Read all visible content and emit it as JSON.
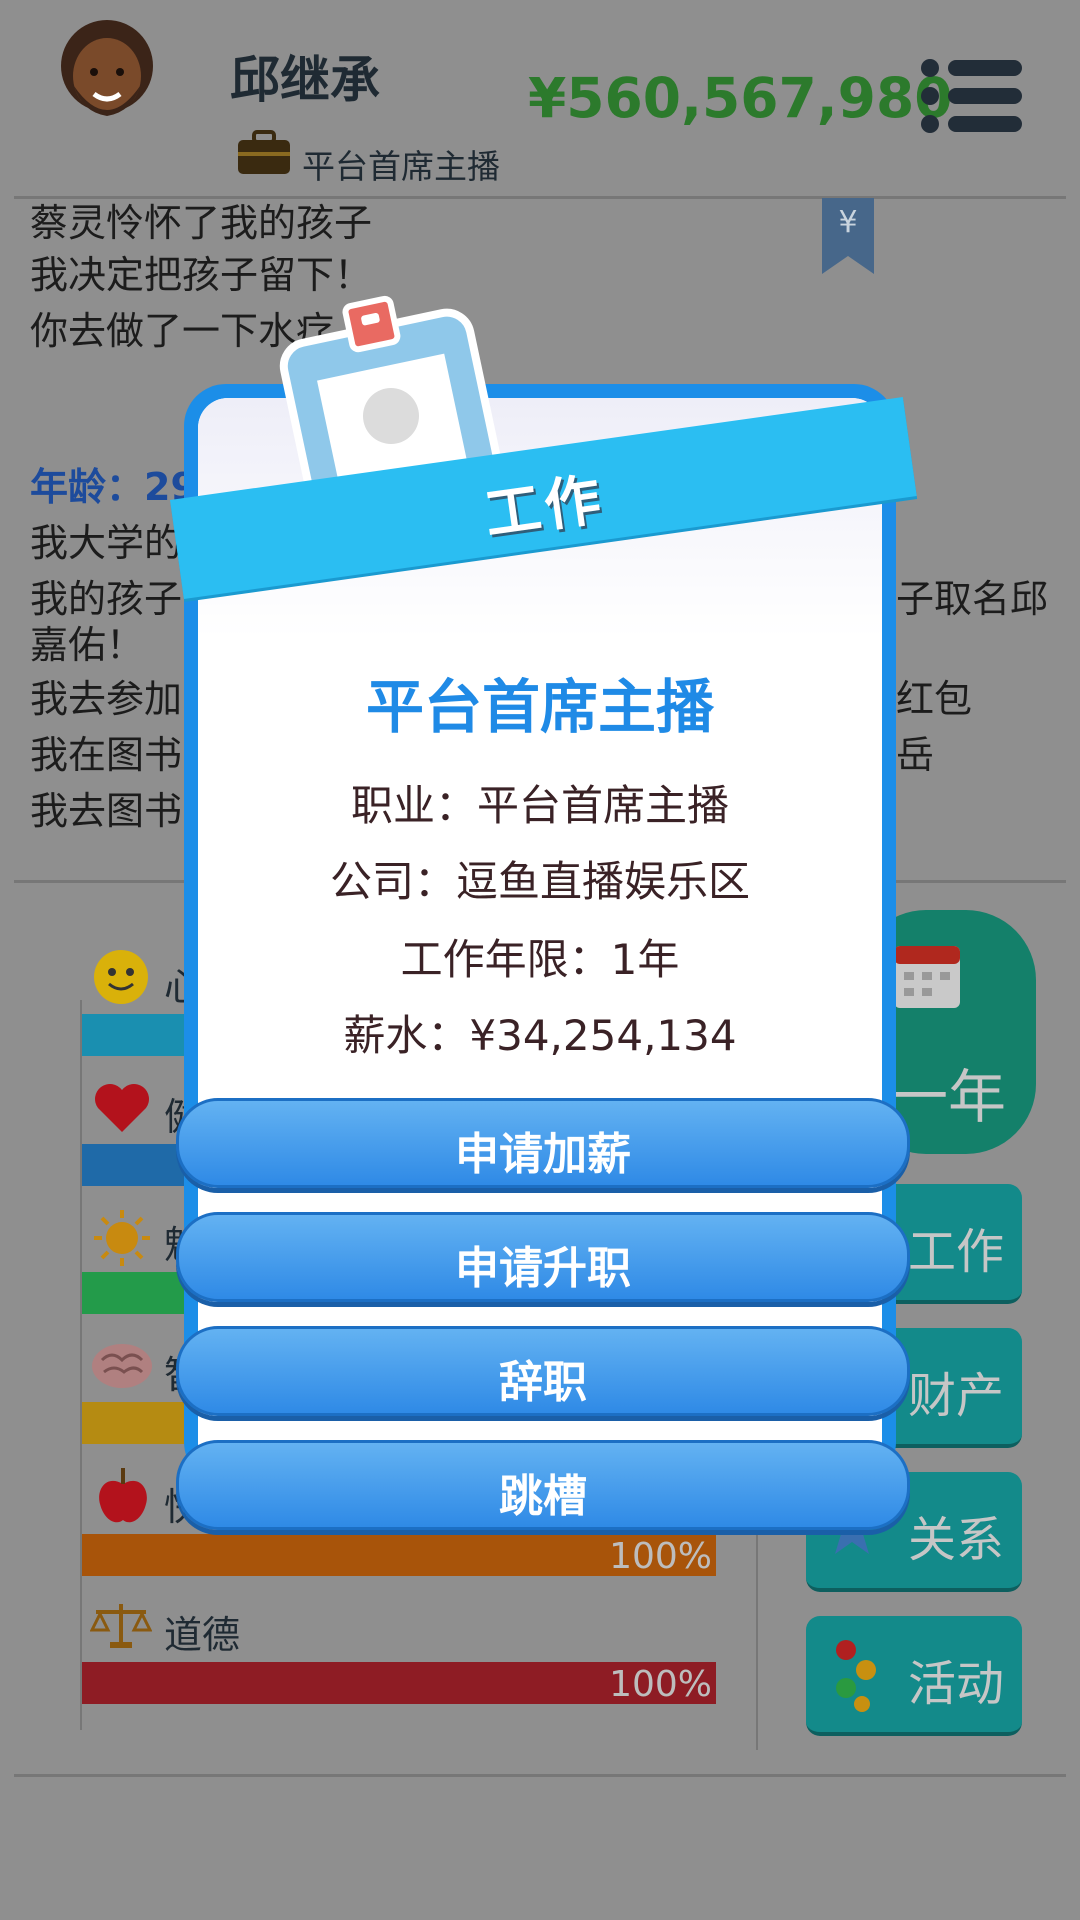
{
  "header": {
    "name": "邱继承",
    "job": "平台首席主播",
    "money": "¥560,567,980"
  },
  "log": {
    "lines_top": [
      "蔡灵怜怀了我的孩子",
      "我决定把孩子留下！",
      "你去做了一下水疗"
    ],
    "age_label": "年龄：29",
    "lines_bottom": [
      "我大学的",
      "我的孩子",
      "嘉佑！",
      "我去参加",
      "我在图书",
      "我去图书"
    ],
    "right_fragments": [
      "子取名邱",
      "红包",
      "岳"
    ]
  },
  "stats": {
    "items": [
      {
        "label": "心",
        "icon": "smiley-icon",
        "color": "#1a8fb0"
      },
      {
        "label": "健",
        "icon": "heart-icon",
        "color": "#1f6aa8"
      },
      {
        "label": "魅",
        "icon": "sun-icon",
        "color": "#239b4a"
      },
      {
        "label": "智",
        "icon": "brain-icon",
        "color": "#b58b12"
      },
      {
        "label": "快",
        "icon": "apple-icon",
        "color": "#a8540a",
        "pct": "100%",
        "level": 1.0
      },
      {
        "label": "道德",
        "icon": "scales-icon",
        "color": "#8e1c24",
        "pct": "100%",
        "level": 1.0
      }
    ]
  },
  "side_buttons": {
    "year_label": "一年",
    "work": "工作",
    "assets": "财产",
    "relations": "关系",
    "activities": "活动"
  },
  "modal": {
    "ribbon_title": "工作",
    "job_title": "平台首席主播",
    "occupation": "职业：平台首席主播",
    "company": "公司：逗鱼直播娱乐区",
    "years": "工作年限：1年",
    "salary": "薪水：¥34,254,134",
    "buttons": {
      "raise": "申请加薪",
      "promote": "申请升职",
      "resign": "辞职",
      "switch": "跳槽"
    }
  }
}
